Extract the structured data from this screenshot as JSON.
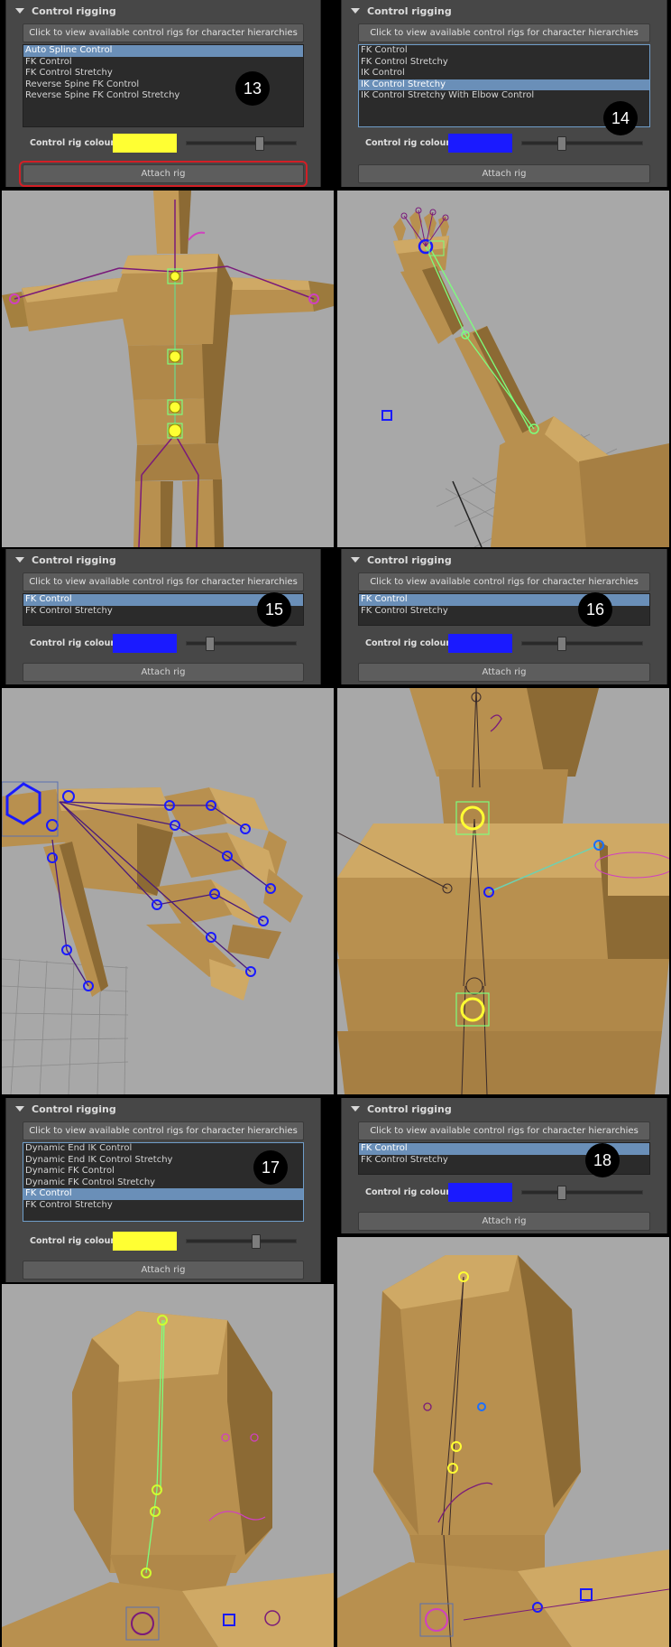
{
  "panels": [
    {
      "title": "Control rigging",
      "view_button": "Click to view available control rigs for character hierarchies",
      "items": [
        "Auto Spline Control",
        "FK Control",
        "FK Control Stretchy",
        "Reverse Spine FK Control",
        "Reverse Spine FK Control Stretchy"
      ],
      "selected": 0,
      "colour_label": "Control rig colour",
      "colour": "#ffff33",
      "slider_value": 0.66,
      "attach_label": "Attach rig",
      "step": "13"
    },
    {
      "title": "Control rigging",
      "view_button": "Click to view available control rigs for character hierarchies",
      "items": [
        "FK Control",
        "FK Control Stretchy",
        "IK Control",
        "IK Control Stretchy",
        "IK Control Stretchy With Elbow Control"
      ],
      "selected": 3,
      "colour_label": "Control rig colour",
      "colour": "#1a1aff",
      "slider_value": 0.32,
      "attach_label": "Attach rig",
      "step": "14"
    },
    {
      "title": "Control rigging",
      "view_button": "Click to view available control rigs for character hierarchies",
      "items": [
        "FK Control",
        "FK Control Stretchy"
      ],
      "selected": 0,
      "colour_label": "Control rig colour",
      "colour": "#1a1aff",
      "slider_value": 0.21,
      "attach_label": "Attach rig",
      "step": "15"
    },
    {
      "title": "Control rigging",
      "view_button": "Click to view available control rigs for character hierarchies",
      "items": [
        "FK Control",
        "FK Control Stretchy"
      ],
      "selected": 0,
      "colour_label": "Control rig colour",
      "colour": "#1a1aff",
      "slider_value": 0.32,
      "attach_label": "Attach rig",
      "step": "16"
    },
    {
      "title": "Control rigging",
      "view_button": "Click to view available control rigs for character hierarchies",
      "items": [
        "Dynamic End IK Control",
        "Dynamic End IK Control Stretchy",
        "Dynamic FK Control",
        "Dynamic FK Control Stretchy",
        "FK Control",
        "FK Control Stretchy"
      ],
      "selected": 4,
      "colour_label": "Control rig colour",
      "colour": "#ffff33",
      "slider_value": 0.63,
      "attach_label": "Attach rig",
      "step": "17"
    },
    {
      "title": "Control rigging",
      "view_button": "Click to view available control rigs for character hierarchies",
      "items": [
        "FK Control",
        "FK Control Stretchy"
      ],
      "selected": 0,
      "colour_label": "Control rig colour",
      "colour": "#1a1aff",
      "slider_value": 0.32,
      "attach_label": "Attach rig",
      "step": "18"
    }
  ],
  "viewport_palette": {
    "background": "#a8a8a8",
    "body": "#b8904f",
    "body_dark": "#8c6a34",
    "body_light": "#cfa965",
    "joint": "#7a1a7a",
    "control_yellow": "#ffff33",
    "control_green": "#7dff7d",
    "control_blue": "#1a1aff",
    "control_magenta": "#d040c0",
    "grid": "#8a8a8a"
  },
  "viewports": [
    {
      "view": "torso-front"
    },
    {
      "view": "arm-ik"
    },
    {
      "view": "hand-fingers"
    },
    {
      "view": "chest-closeup"
    },
    {
      "view": "head-neck"
    },
    {
      "view": "head-neck-blue"
    }
  ]
}
